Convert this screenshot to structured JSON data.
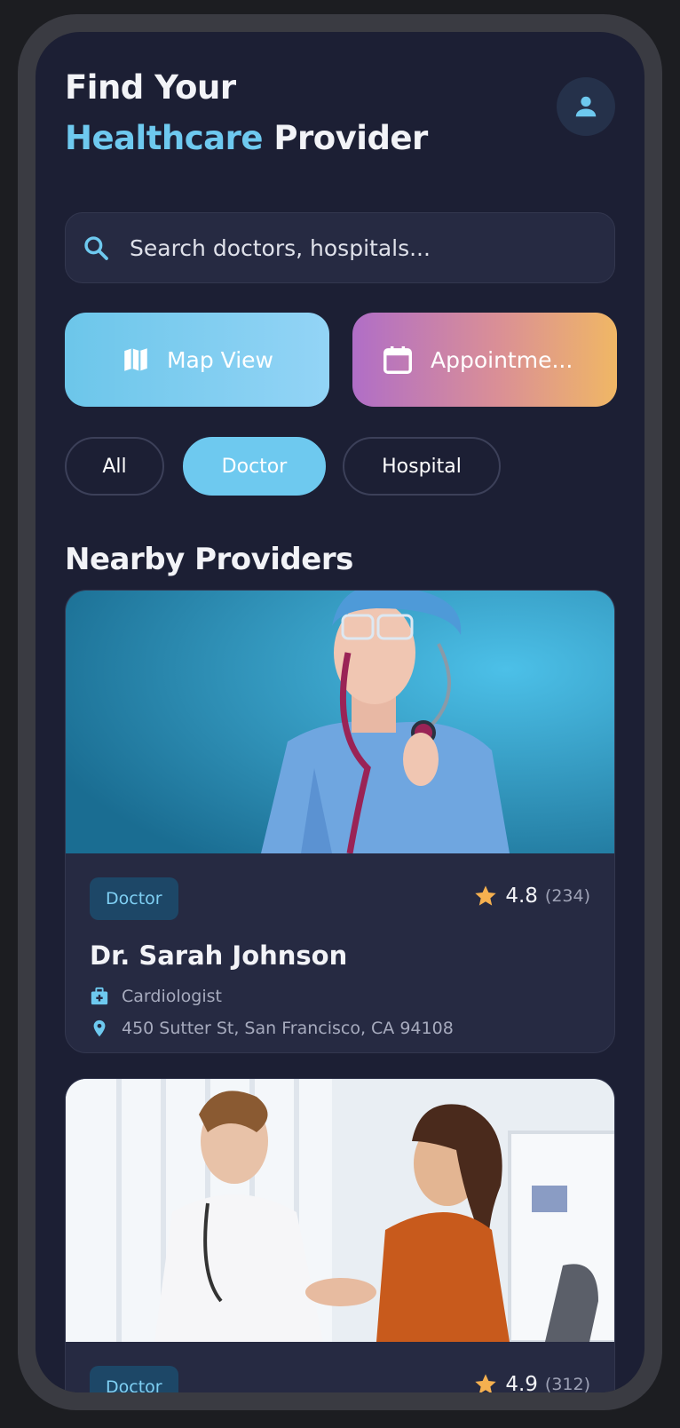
{
  "header": {
    "title_line1": "Find Your",
    "title_accent": "Healthcare",
    "title_rest": " Provider",
    "profile_icon": "person-icon"
  },
  "search": {
    "placeholder": "Search doctors, hospitals...",
    "icon": "search-icon"
  },
  "actions": {
    "map_label": "Map View",
    "appointments_label": "Appointme..."
  },
  "filters": [
    {
      "label": "All",
      "active": false
    },
    {
      "label": "Doctor",
      "active": true
    },
    {
      "label": "Hospital",
      "active": false
    }
  ],
  "section_title": "Nearby Providers",
  "providers": [
    {
      "type": "Doctor",
      "rating": "4.8",
      "reviews": "(234)",
      "name": "Dr. Sarah Johnson",
      "specialty": "Cardiologist",
      "address": "450 Sutter St, San Francisco, CA 94108"
    },
    {
      "type": "Doctor",
      "rating": "4.9",
      "reviews": "(312)"
    }
  ],
  "colors": {
    "accent": "#6ec9ef",
    "background": "#1c1f34",
    "card": "#262a42",
    "star": "#f5b04f"
  }
}
